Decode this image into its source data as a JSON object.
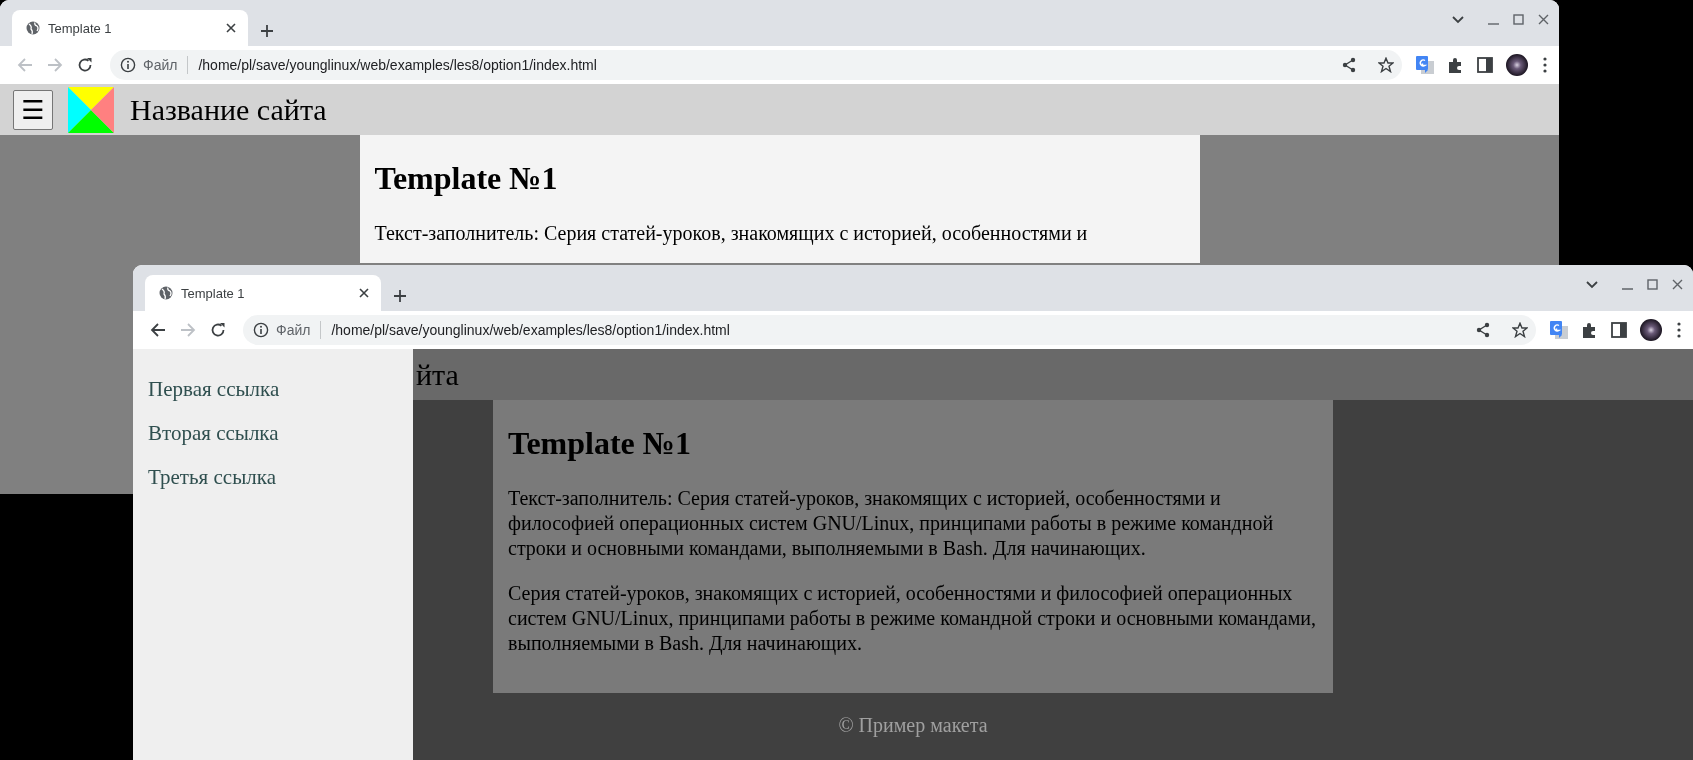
{
  "windows": [
    {
      "tab": {
        "title": "Template 1",
        "selected": true
      },
      "nav": {
        "back_disabled": true,
        "forward_disabled": true
      },
      "address": {
        "label": "Файл",
        "url": "/home/pl/save/younglinux/web/examples/les8/option1/index.html"
      },
      "page": {
        "menu_open": false,
        "menu_button": "☰",
        "site_title": "Название сайта",
        "heading": "Template №1",
        "paragraphs": [
          "Текст-заполнитель: Серия статей-уроков, знакомящих с историей, особенностями и"
        ]
      }
    },
    {
      "tab": {
        "title": "Template 1",
        "selected": true
      },
      "nav": {
        "back_disabled": false,
        "forward_disabled": true
      },
      "address": {
        "label": "Файл",
        "url": "/home/pl/save/younglinux/web/examples/les8/option1/index.html"
      },
      "page": {
        "menu_open": true,
        "site_title": "йта",
        "menu_links": [
          "Первая ссылка",
          "Вторая ссылка",
          "Третья ссылка"
        ],
        "heading": "Template №1",
        "paragraphs": [
          "Текст-заполнитель: Серия статей-уроков, знакомящих с историей, особенностями и философией операционных систем GNU/Linux, принципами работы в режиме командной строки и основными командами, выполняемыми в Bash. Для начинающих.",
          "Серия статей-уроков, знакомящих с историей, особенностями и философией операционных систем GNU/Linux, принципами работы в режиме командной строки и основными командами, выполняемыми в Bash. Для начинающих."
        ],
        "footer": "© Пример макета"
      }
    }
  ]
}
